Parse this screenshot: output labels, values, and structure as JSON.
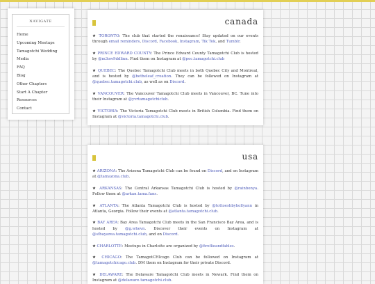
{
  "nav": {
    "title": "NAVIGATE",
    "items": [
      "Home",
      "Upcoming Meetups",
      "Tamagotchi Wedding",
      "Media",
      "FAQ",
      "Blog",
      "Other Chapters",
      "Start A Chapter",
      "Resources",
      "Contact"
    ]
  },
  "canada": {
    "title": "canada",
    "entries": [
      [
        "★ ",
        {
          "l": "TORONTO"
        },
        ": The club that started the renaissance! Stay updated on our events through ",
        {
          "l": "email reminders"
        },
        ", ",
        {
          "l": "Discord"
        },
        ", ",
        {
          "l": "Facebook"
        },
        ", ",
        {
          "l": "Instagram"
        },
        ", ",
        {
          "l": "Tik Tok"
        },
        ", and ",
        {
          "l": "Tumblr"
        },
        "."
      ],
      [
        "★ ",
        {
          "l": "PRINCE EDWARD COUNTY"
        },
        ": The Prince Edward County Tamagotchi Club is hosted by ",
        {
          "l": "@m3ow9ddlinn"
        },
        ". Find them on Instagram at ",
        {
          "l": "@pec.tamagotchi.club"
        }
      ],
      [
        "★ ",
        {
          "l": "QUEBEC"
        },
        ": The Quebec Tamagotchi Club meets in both Quebec City and Montreal, and is hosted by ",
        {
          "l": "@betheleaf_creation"
        },
        ". They can be followed on Instagram at ",
        {
          "l": "@quebec.tamagotchi.club"
        },
        ", as well as on ",
        {
          "l": "Discord"
        },
        "."
      ],
      [
        "★ ",
        {
          "l": "VANCOUVER"
        },
        ": The Vancouver Tamagotchi Club meets in Vancouver, BC. Tune into their Instagram at ",
        {
          "l": "@yvrtamagotchiclub"
        },
        "."
      ],
      [
        "★ ",
        {
          "l": "VICTORIA"
        },
        ": The Victoria Tamagotchi Club meets in British Columbia. Find them on Instagram at ",
        {
          "l": "@victoria.tamagotchi.club"
        },
        "."
      ]
    ]
  },
  "usa": {
    "title": "usa",
    "entries": [
      [
        "★ ",
        {
          "l": "ARIZONA"
        },
        ": The Arizona Tamagotchi Club can be found on ",
        {
          "l": "Discord"
        },
        ", and on Instagram at ",
        {
          "l": "@tamazona.club"
        },
        "."
      ],
      [
        "★ ",
        {
          "l": "ARKANSAS"
        },
        ": The Central Arkansas Tamagotchi Club is hosted by ",
        {
          "l": "@rainbonya"
        },
        ". Follow them at ",
        {
          "l": "@arkan.tama.fans"
        },
        "."
      ],
      [
        "★ ",
        {
          "l": "ATLANTA"
        },
        ": The Atlanta Tamagotchi Club is hosted by ",
        {
          "l": "@tottoeshbyhollyann"
        },
        " in Atlanta, Georgia. Follow their events at ",
        {
          "l": "@atlanta.tamagotchi.club"
        },
        "."
      ],
      [
        "★ ",
        {
          "l": "BAY AREA"
        },
        ": Bay Area Tamagotchi Club meets in the San Francisco Bay Area, and is hosted by ",
        {
          "l": "@g.whevn"
        },
        ". Discover their events on Instagram at ",
        {
          "l": "@sfbayarea.tamagotchi.club"
        },
        ", and on ",
        {
          "l": "Discord"
        },
        "."
      ],
      [
        "★ ",
        {
          "l": "CHARLOTTE"
        },
        ": Meetups in Charlotte are organized by ",
        {
          "l": "@fireflieandfables"
        },
        "."
      ],
      [
        "★ ",
        {
          "l": "CHICAGO"
        },
        ": The TamagotCHIcago Club can be followed on Instagram at ",
        {
          "l": "@tamagotchicago.club"
        },
        ". DM them on Instagram for their private Discord."
      ],
      [
        "★ ",
        {
          "l": "DELAWARE"
        },
        ": The Delaware Tamagotchi Club meets in Newark. Find them on Instagram at ",
        {
          "l": "@delaware.tamagotchi.club"
        },
        "."
      ]
    ]
  },
  "colors": {
    "accent": "#e2cf55",
    "link": "#4b59b8",
    "marker": "#d8c43c"
  }
}
